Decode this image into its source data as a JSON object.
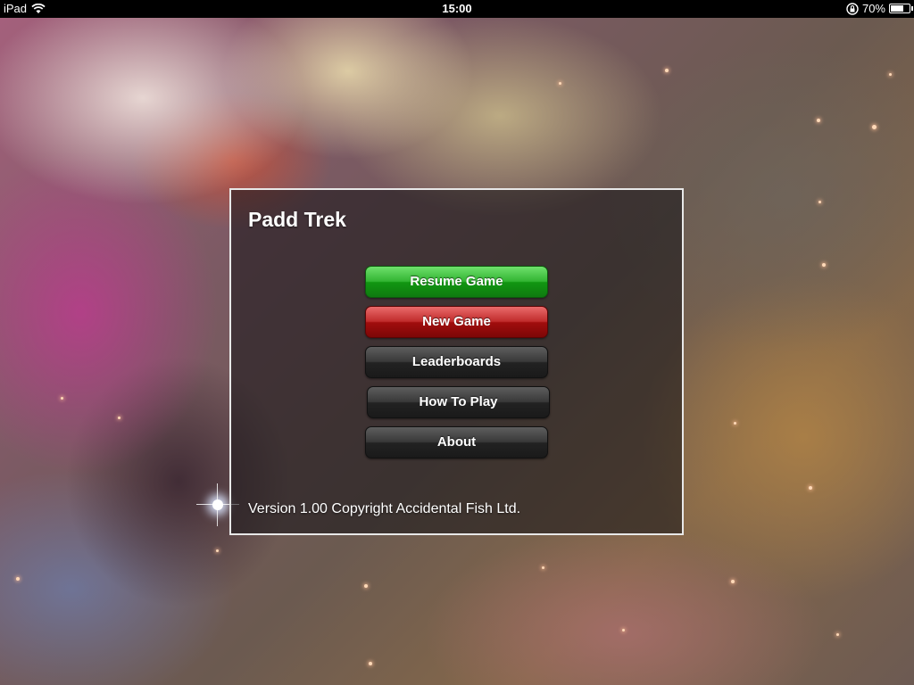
{
  "status_bar": {
    "device": "iPad",
    "time": "15:00",
    "battery_percent_label": "70%",
    "battery_level": 0.7,
    "icons": [
      "wifi-icon",
      "orientation-lock-icon",
      "battery-icon"
    ]
  },
  "menu": {
    "title": "Padd Trek",
    "buttons": [
      {
        "label": "Resume Game",
        "color": "#22a822"
      },
      {
        "label": "New Game",
        "color": "#b01414"
      },
      {
        "label": "Leaderboards",
        "color": "#2a2a2a"
      },
      {
        "label": "How To Play",
        "color": "#2a2a2a"
      },
      {
        "label": "About",
        "color": "#2a2a2a"
      }
    ],
    "version_text": "Version 1.00 Copyright Accidental Fish Ltd."
  }
}
